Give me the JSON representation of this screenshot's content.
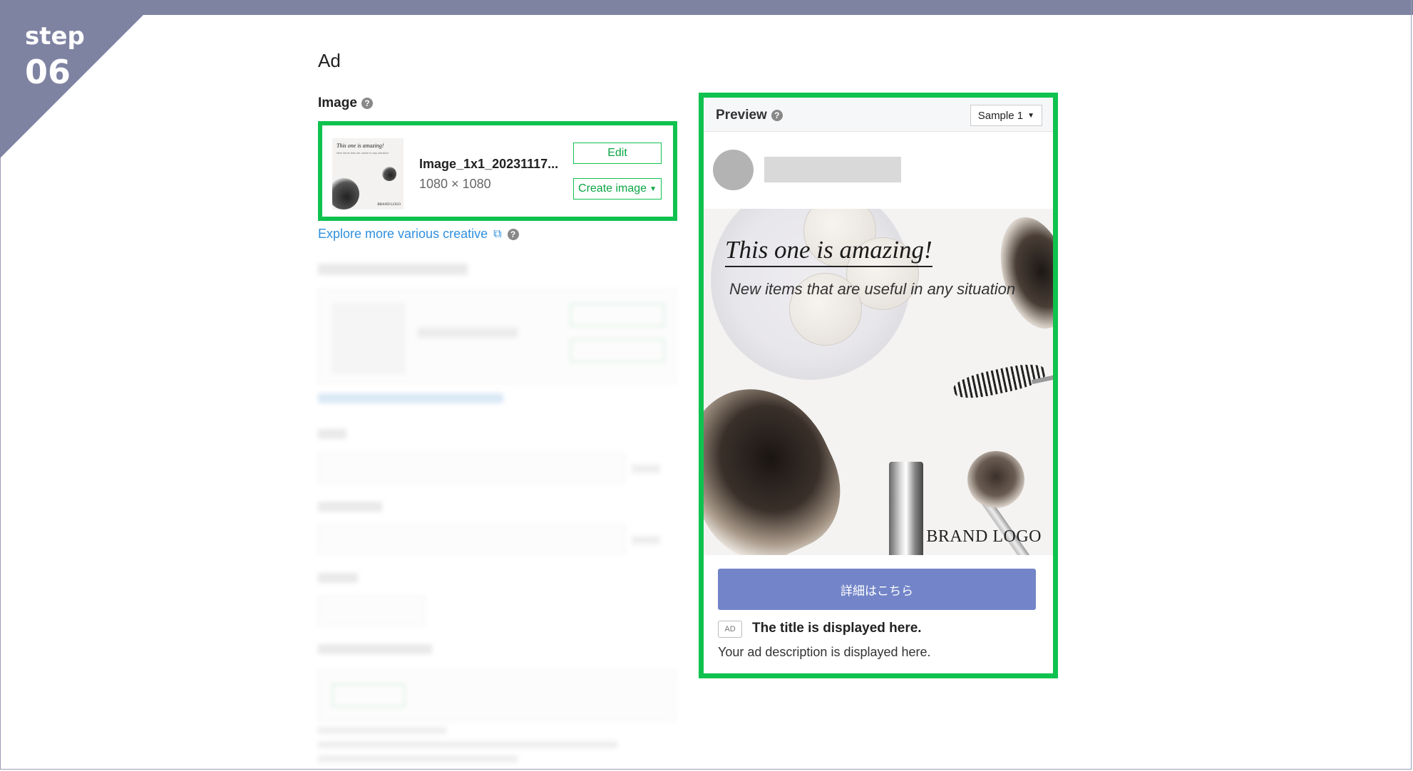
{
  "step": {
    "label": "step",
    "number": "06"
  },
  "section": {
    "title": "Ad"
  },
  "image_field": {
    "label": "Image",
    "help_icon": "?",
    "file_name": "Image_1x1_20231117...",
    "dimensions": "1080 × 1080",
    "edit_label": "Edit",
    "create_label": "Create image",
    "thumbnail": {
      "headline": "This one is amazing!",
      "subline": "New items that are useful in any situation",
      "logo": "BRAND LOGO"
    }
  },
  "explore_link": {
    "label": "Explore more various creative"
  },
  "preview": {
    "title": "Preview",
    "sample_select": "Sample 1",
    "image": {
      "headline": "This one is amazing!",
      "subline": "New items that are useful in any situation",
      "logo": "BRAND LOGO"
    },
    "cta_label": "詳細はこちら",
    "ad_badge": "AD",
    "ad_title": "The title is displayed here.",
    "ad_description": "Your ad description is displayed here."
  },
  "colors": {
    "highlight": "#0fc24f",
    "step_bg": "#7f83a2",
    "cta_bg": "#7385c8",
    "link": "#2f8fde"
  }
}
